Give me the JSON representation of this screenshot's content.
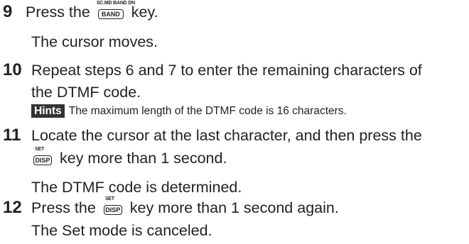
{
  "steps": [
    {
      "number": "9",
      "text_before": "Press the",
      "key": {
        "label": "BAND",
        "sub_label": "SC.MD BAND DN"
      },
      "text_after": "key.",
      "result": "The cursor moves."
    },
    {
      "number": "10",
      "line1": "Repeat steps 6 and 7 to enter the remaining characters of",
      "line2": "the DTMF code.",
      "hints_label": "Hints",
      "hints_text": "The maximum length of the DTMF code is 16 characters."
    },
    {
      "number": "11",
      "line1": "Locate the cursor at the last character, and then press the",
      "key": {
        "label": "DISP",
        "sub_label": "SET"
      },
      "text_after": "key more than 1 second.",
      "result": "The DTMF code is determined."
    },
    {
      "number": "12",
      "text_before": "Press the",
      "key": {
        "label": "DISP",
        "sub_label": "SET"
      },
      "text_after": "key more than 1 second again.",
      "result": "The Set mode is canceled."
    }
  ]
}
